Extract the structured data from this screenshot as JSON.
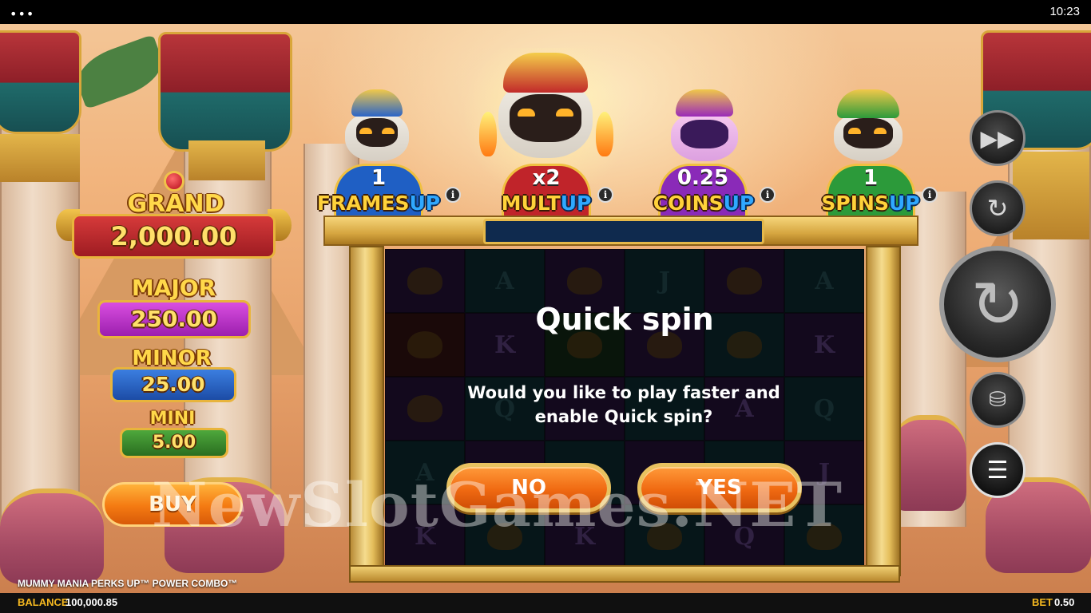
{
  "status_bar": {
    "menu_dots": "•••",
    "time": "10:23"
  },
  "jackpots": {
    "grand": {
      "label": "GRAND",
      "value": "2,000.00",
      "color": "#d63a3a"
    },
    "major": {
      "label": "MAJOR",
      "value": "250.00",
      "color": "#c23bd1"
    },
    "minor": {
      "label": "MINOR",
      "value": "25.00",
      "color": "#2c66c8"
    },
    "mini": {
      "label": "MINI",
      "value": "5.00",
      "color": "#3e8e30"
    }
  },
  "buy_button": {
    "label": "BUY"
  },
  "perks": [
    {
      "value": "1",
      "label": "FRAMES",
      "suffix": "UP",
      "color": "#1f5fc4",
      "icon": "blue-mummy-icon"
    },
    {
      "value": "x2",
      "label": "MULT",
      "suffix": "UP",
      "color": "#c0242a",
      "icon": "red-mummy-icon"
    },
    {
      "value": "0.25",
      "label": "COINS",
      "suffix": "UP",
      "color": "#8a2ab8",
      "icon": "purple-mummy-icon"
    },
    {
      "value": "1",
      "label": "SPINS",
      "suffix": "UP",
      "color": "#2c9a3a",
      "icon": "green-mummy-icon"
    }
  ],
  "info_glyph": "i",
  "grid_symbols": [
    [
      "scarab",
      "A",
      "scarab",
      "J",
      "scarab",
      "A"
    ],
    [
      "scarab",
      "K",
      "scarab",
      "scarab",
      "scarab",
      "K"
    ],
    [
      "scarab",
      "Q",
      "",
      "",
      "A",
      "Q"
    ],
    [
      "A",
      "",
      "",
      "",
      "",
      "J"
    ],
    [
      "K",
      "scarab",
      "K",
      "scarab",
      "Q",
      "scarab"
    ]
  ],
  "dialog": {
    "title": "Quick spin",
    "message": "Would you like to play faster and enable Quick spin?",
    "no_label": "NO",
    "yes_label": "YES"
  },
  "watermark": "NewSlotGames.NET",
  "controls": {
    "turbo_icon": "fast-forward-icon",
    "autoplay_icon": "autoplay-icon",
    "spin_icon": "spin-icon",
    "bet_icon": "coins-icon",
    "menu_icon": "hamburger-menu-icon"
  },
  "footer": {
    "game_name": "MUMMY MANIA PERKS UP™ POWER COMBO™",
    "balance_label": "BALANCE",
    "balance_value": "100,000.85",
    "bet_label": "BET",
    "bet_value": "0.50"
  }
}
